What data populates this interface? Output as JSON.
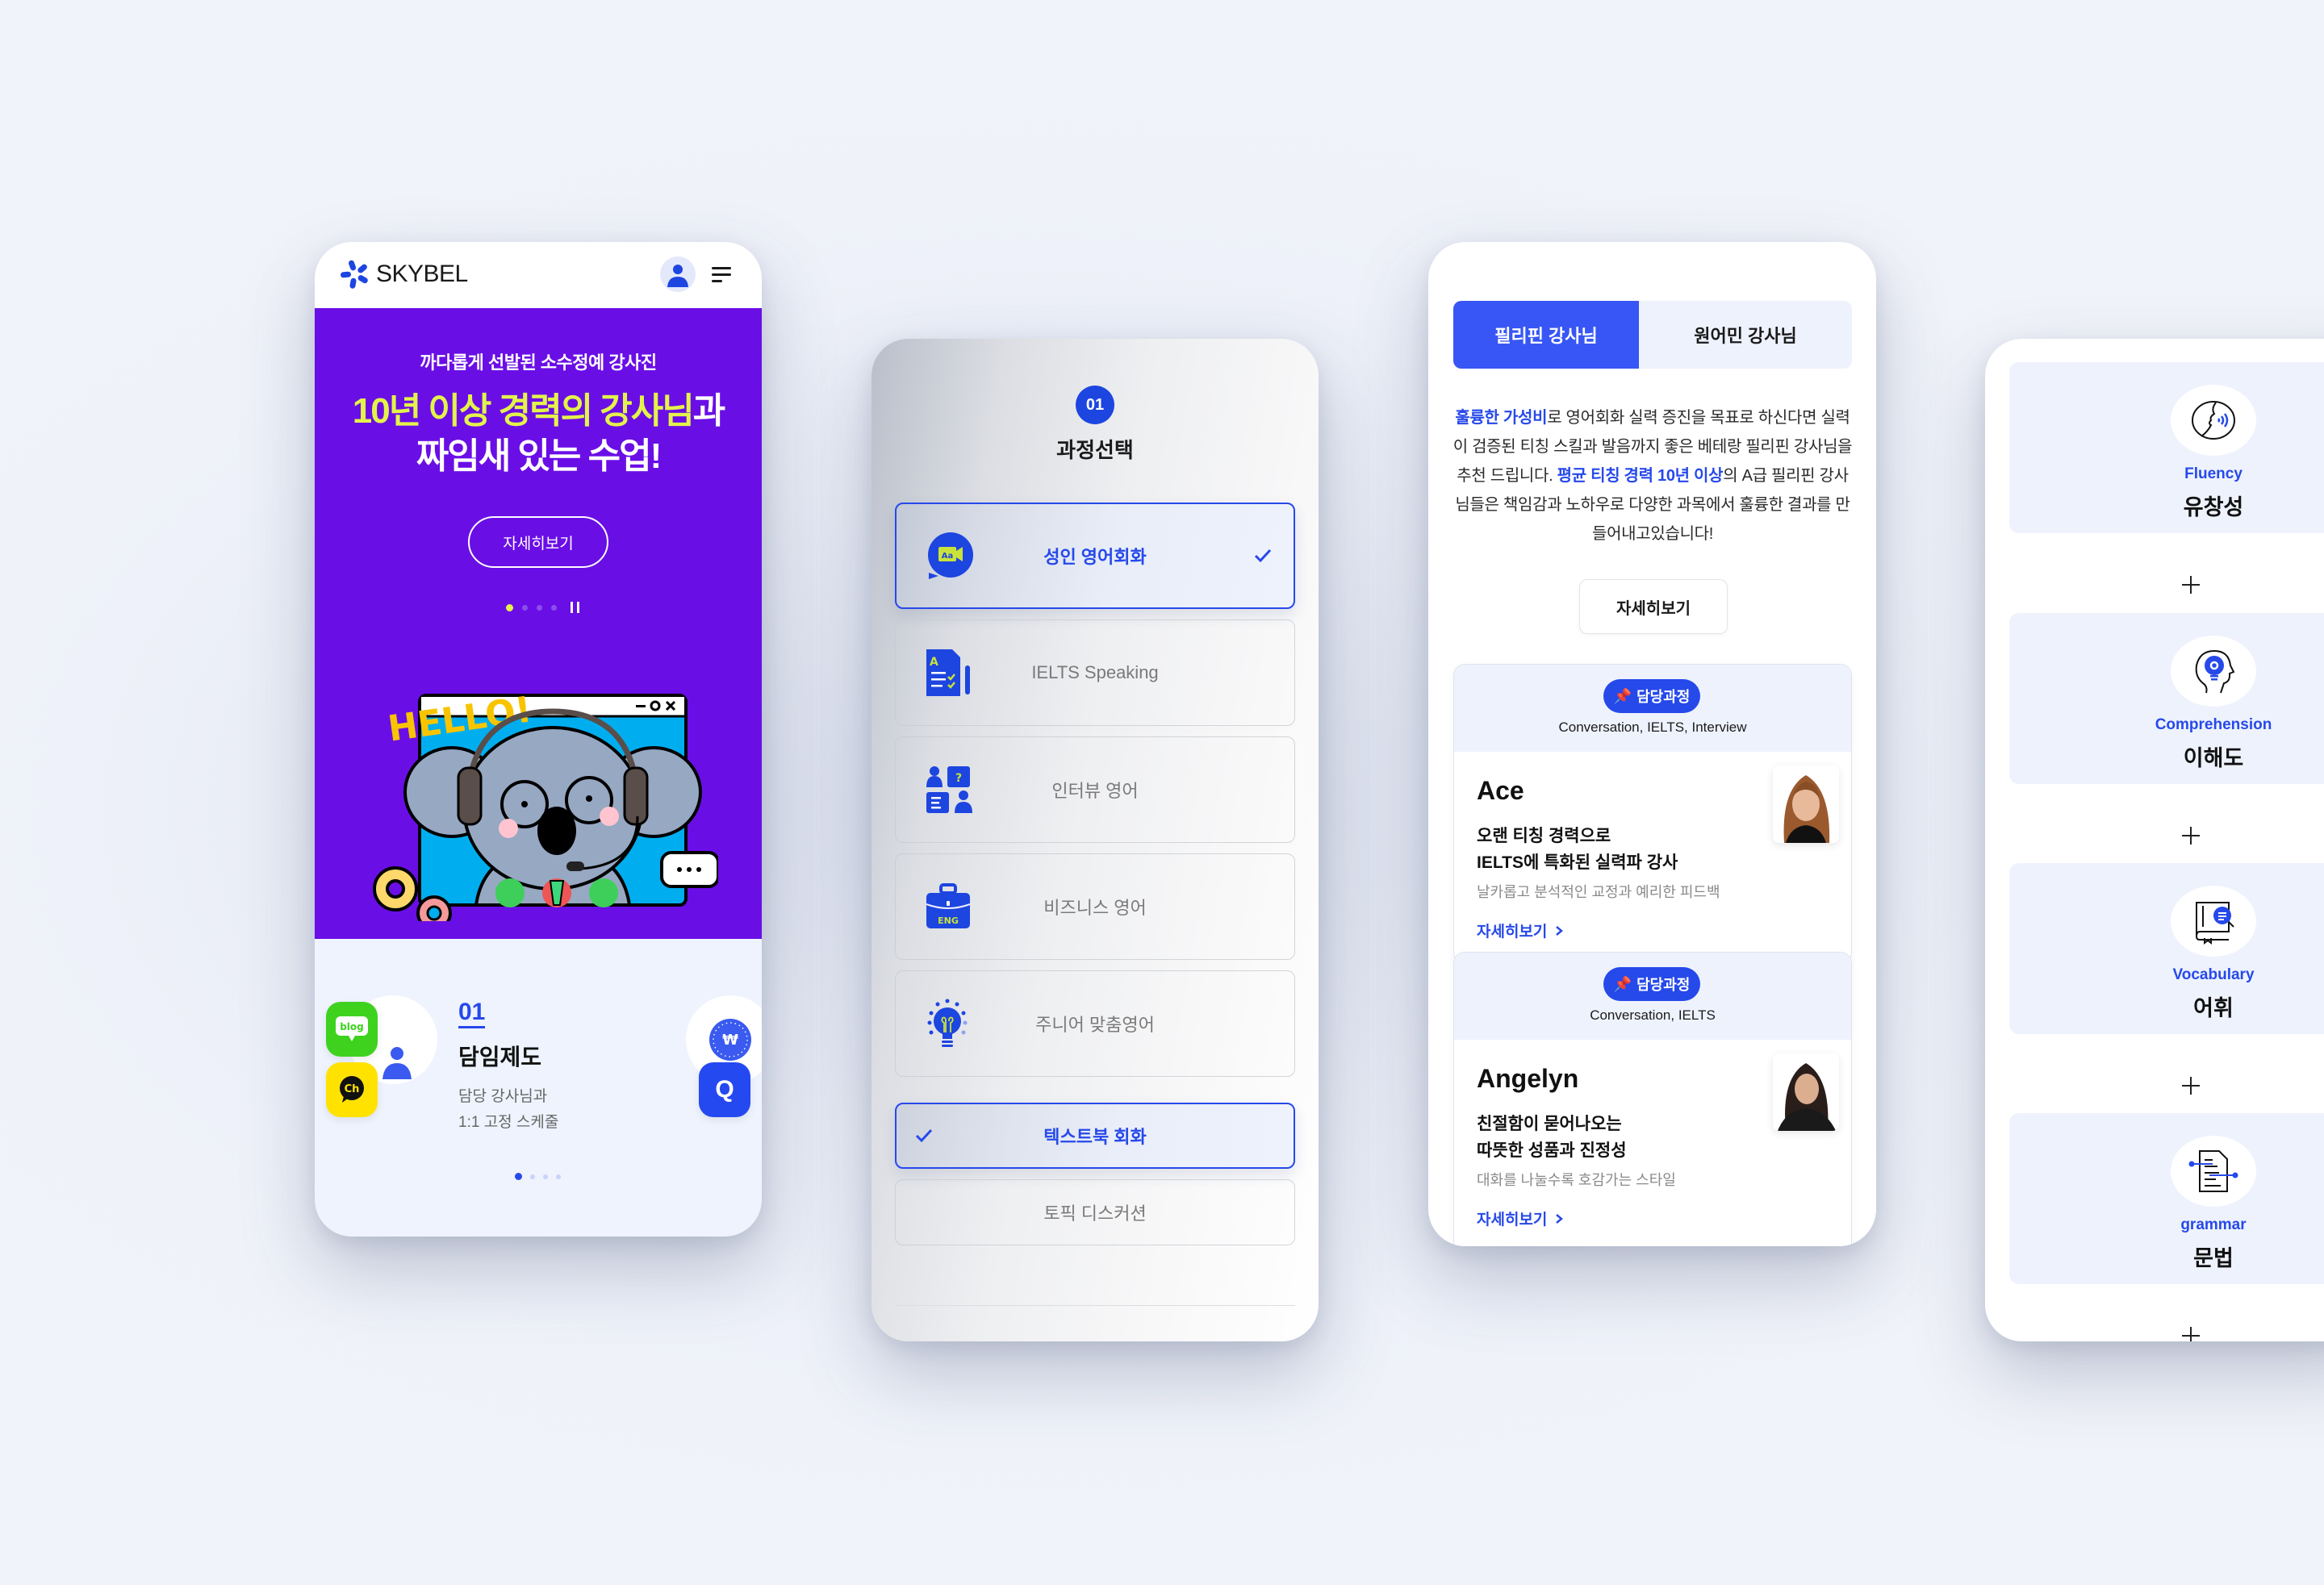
{
  "colors": {
    "brand_blue": "#2649ea",
    "hero_purple": "#6a0ee6",
    "hero_highlight": "#e3f34a",
    "tab_active": "#3756f5",
    "soft_bg": "#eef2fc"
  },
  "home_screen": {
    "logo_text": "SKYBEL",
    "icons": {
      "logo": "skybel-star-icon",
      "user": "user-avatar-icon",
      "menu": "hamburger-menu-icon"
    },
    "hero": {
      "subtitle": "까다롭게 선발된 소수정예 강사진",
      "title_line1_highlight": "10년 이상 경력의 강사님",
      "title_line1_rest": "과",
      "title_line2": "짜임새 있는 수업!",
      "cta_label": "자세히보기",
      "slides_total": 4,
      "slide_active": 1,
      "illustration_text": "HELLO!",
      "illustration": "koala-video-call-illustration"
    },
    "feature": {
      "number": "01",
      "title": "담임제도",
      "desc_line1": "담당 강사님과",
      "desc_line2": "1:1 고정 스케줄",
      "left_apps": [
        "blog",
        "Ch"
      ],
      "right_app": "Q",
      "slides_total": 4,
      "slide_active": 1
    }
  },
  "course_screen": {
    "step_number": "01",
    "title": "과정선택",
    "courses": [
      {
        "label": "성인 영어회화",
        "icon": "video-chat-aa-icon",
        "selected": true
      },
      {
        "label": "IELTS Speaking",
        "icon": "test-document-icon",
        "selected": false
      },
      {
        "label": "인터뷰 영어",
        "icon": "interview-people-icon",
        "selected": false
      },
      {
        "label": "비즈니스 영어",
        "icon": "briefcase-eng-icon",
        "selected": false
      },
      {
        "label": "주니어 맞춤영어",
        "icon": "lightbulb-icon",
        "selected": false
      }
    ],
    "sub_options": [
      {
        "label": "텍스트북 회화",
        "selected": true
      },
      {
        "label": "토픽 디스커션",
        "selected": false
      }
    ]
  },
  "teacher_screen": {
    "tabs": [
      {
        "label": "필리핀 강사님",
        "active": true
      },
      {
        "label": "원어민 강사님",
        "active": false
      }
    ],
    "intro": {
      "part1_bold": "훌륭한 가성비",
      "part2": "로 영어회화 실력 증진을 목표로 하신다면 실력이 검증된 티칭 스킬과 발음까지 좋은 베테랑 필리핀 강사님을 추천 드립니다. ",
      "part3_bold": "평균 티칭 경력 10년 이상",
      "part4": "의 A급 필리핀 강사님들은 책임감과 노하우로 다양한 과목에서 훌륭한 결과를 만들어내고있습니다!"
    },
    "more_label": "자세히보기",
    "teachers": [
      {
        "badge": "담당과정",
        "courses": "Conversation, IELTS, Interview",
        "name": "Ace",
        "headline1": "오랜 티칭 경력으로",
        "headline2": "IELTS에 특화된 실력파 강사",
        "desc": "날카롭고 분석적인 교정과 예리한 피드백",
        "link": "자세히보기"
      },
      {
        "badge": "담당과정",
        "courses": "Conversation, IELTS",
        "name": "Angelyn",
        "headline1": "친절함이 묻어나오는",
        "headline2": "따뜻한 성품과 진정성",
        "desc": "대화를 나눌수록 호감가는 스타일",
        "link": "자세히보기"
      }
    ]
  },
  "skills_screen": {
    "skills": [
      {
        "en": "Fluency",
        "ko": "유창성",
        "icon": "speaking-head-icon"
      },
      {
        "en": "Comprehension",
        "ko": "이해도",
        "icon": "head-lightbulb-icon"
      },
      {
        "en": "Vocabulary",
        "ko": "어휘",
        "icon": "book-search-icon"
      },
      {
        "en": "grammar",
        "ko": "문법",
        "icon": "document-lines-icon"
      }
    ]
  }
}
